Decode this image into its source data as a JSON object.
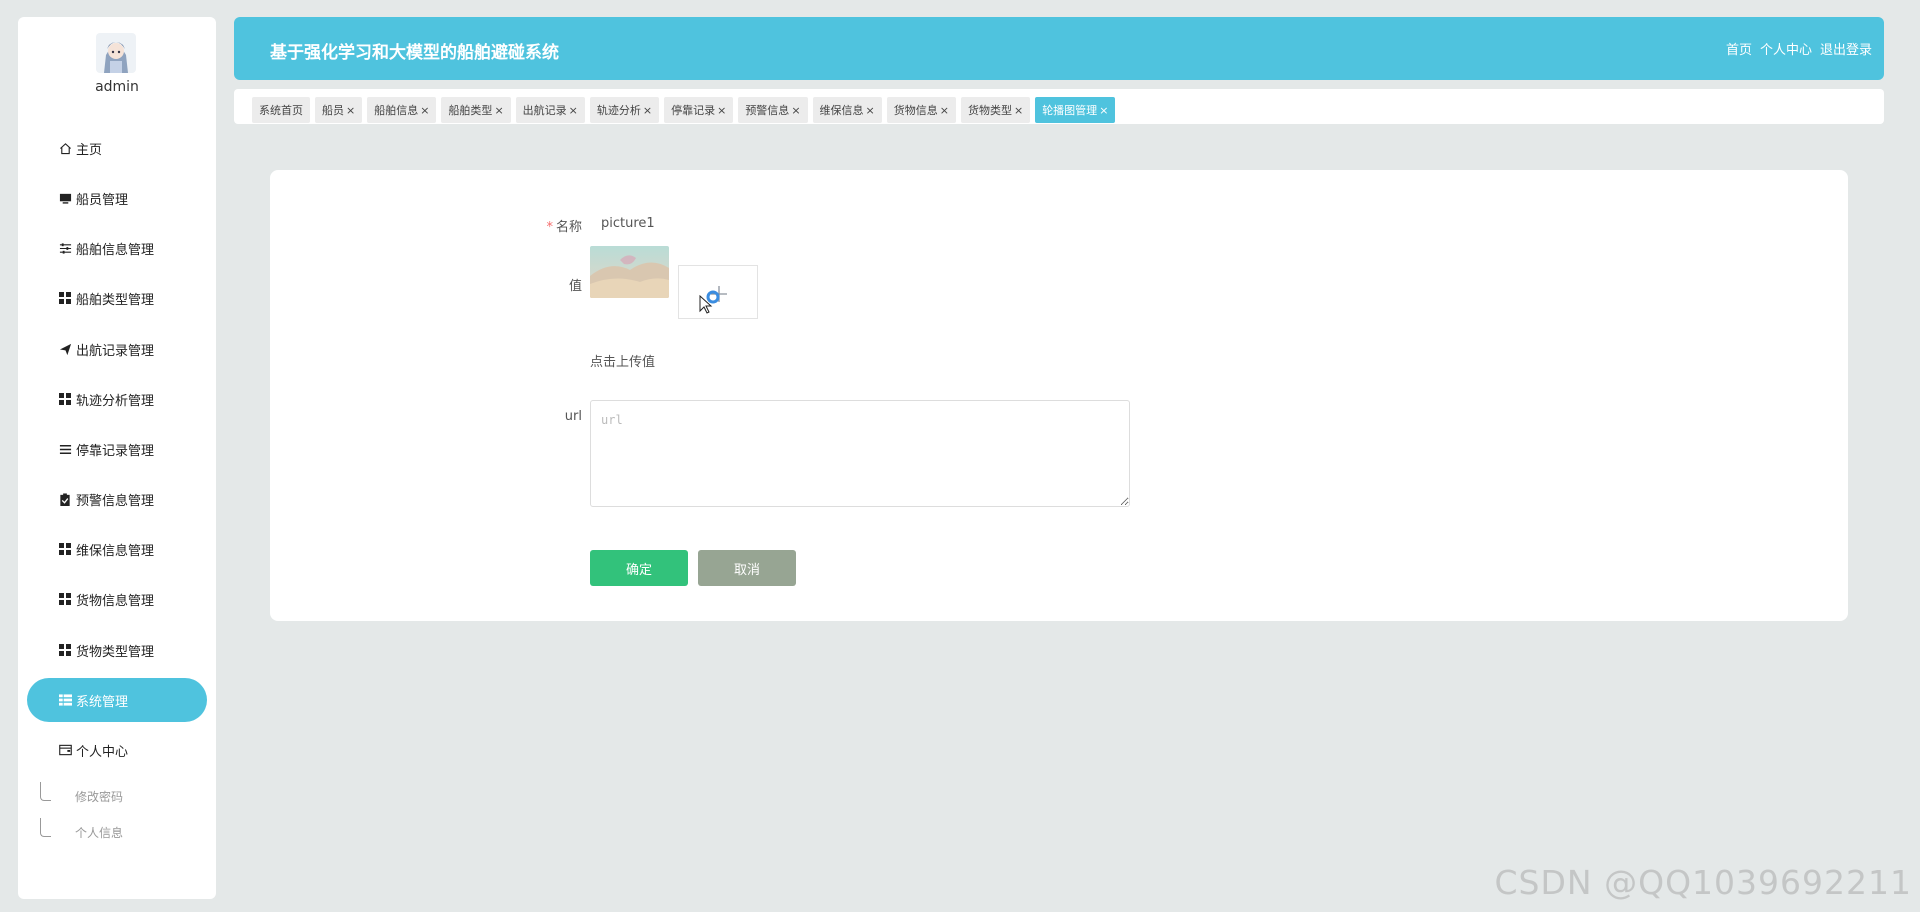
{
  "user": {
    "name": "admin"
  },
  "sidebar": {
    "items": [
      {
        "label": "主页",
        "icon": "home-icon"
      },
      {
        "label": "船员管理",
        "icon": "monitor-icon"
      },
      {
        "label": "船舶信息管理",
        "icon": "sliders-icon"
      },
      {
        "label": "船舶类型管理",
        "icon": "grid-icon"
      },
      {
        "label": "出航记录管理",
        "icon": "send-icon"
      },
      {
        "label": "轨迹分析管理",
        "icon": "grid-icon"
      },
      {
        "label": "停靠记录管理",
        "icon": "list-icon"
      },
      {
        "label": "预警信息管理",
        "icon": "clipboard-icon"
      },
      {
        "label": "维保信息管理",
        "icon": "grid-icon"
      },
      {
        "label": "货物信息管理",
        "icon": "grid-icon"
      },
      {
        "label": "货物类型管理",
        "icon": "grid-icon"
      },
      {
        "label": "系统管理",
        "icon": "table-icon"
      },
      {
        "label": "个人中心",
        "icon": "wallet-icon"
      }
    ],
    "sub_items": [
      {
        "label": "修改密码"
      },
      {
        "label": "个人信息"
      }
    ],
    "active_color": "#4fc3de"
  },
  "header": {
    "title": "基于强化学习和大模型的船舶避碰系统",
    "links": [
      "首页",
      "个人中心",
      "退出登录"
    ],
    "color": "#4fc3de"
  },
  "tabs": [
    {
      "label": "系统首页",
      "closable": false
    },
    {
      "label": "船员",
      "closable": true
    },
    {
      "label": "船舶信息",
      "closable": true
    },
    {
      "label": "船舶类型",
      "closable": true
    },
    {
      "label": "出航记录",
      "closable": true
    },
    {
      "label": "轨迹分析",
      "closable": true
    },
    {
      "label": "停靠记录",
      "closable": true
    },
    {
      "label": "预警信息",
      "closable": true
    },
    {
      "label": "维保信息",
      "closable": true
    },
    {
      "label": "货物信息",
      "closable": true
    },
    {
      "label": "货物类型",
      "closable": true
    },
    {
      "label": "轮播图管理",
      "closable": true,
      "active": true
    }
  ],
  "form": {
    "name_label": "名称",
    "name_value": "picture1",
    "value_label": "值",
    "upload_hint": "点击上传值",
    "url_label": "url",
    "url_placeholder": "url",
    "url_value": "",
    "confirm_label": "确定",
    "cancel_label": "取消",
    "confirm_color": "#32c27b",
    "cancel_color": "#97a593"
  },
  "watermark": "CSDN @QQ1039692211"
}
